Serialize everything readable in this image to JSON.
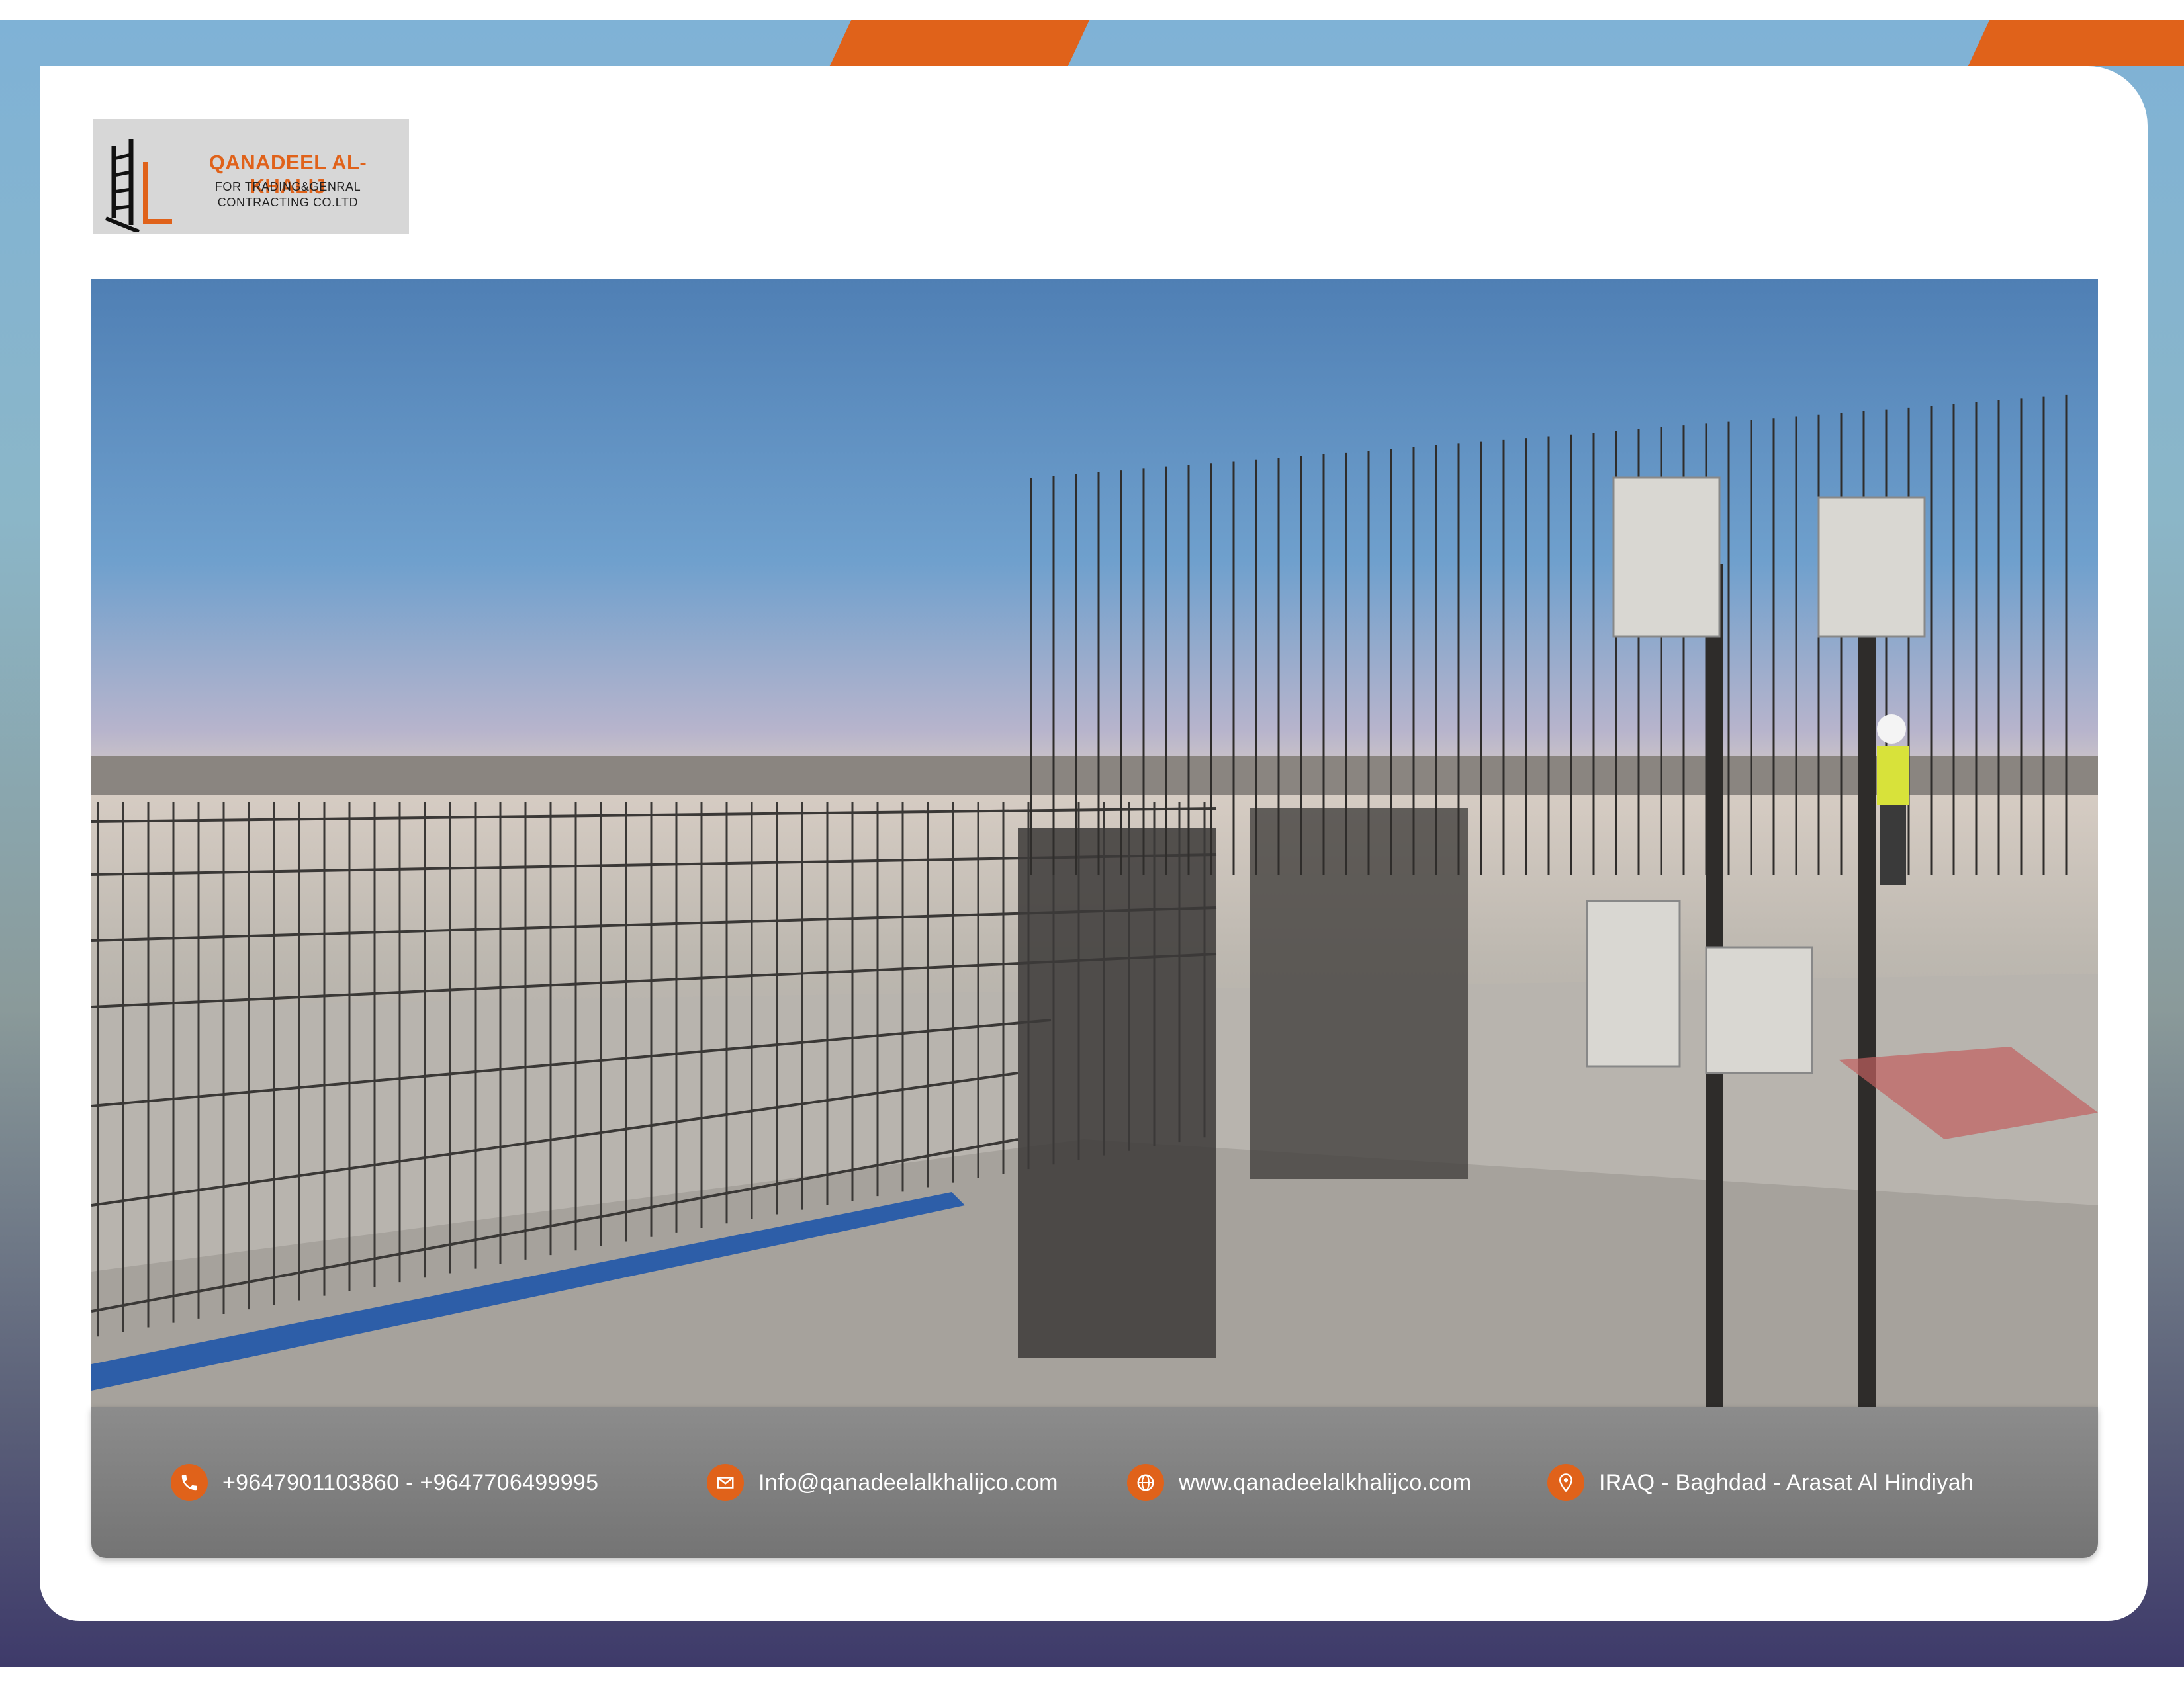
{
  "logo": {
    "brand": "QANADEEL AL-KHALIJ",
    "sub_line1": "FOR TRADING&GENRAL",
    "sub_line2": "CONTRACTING CO.LTD"
  },
  "photo": {
    "subject": "construction site with rebar cages and worker"
  },
  "footer": {
    "phone": "+9647901103860 - +9647706499995",
    "email": "Info@qanadeelalkhalijco.com",
    "website": "www.qanadeelalkhalijco.com",
    "address": "IRAQ - Baghdad - Arasat Al Hindiyah"
  },
  "colors": {
    "accent": "#e0621a",
    "footer_bg": "#7c7c7c"
  },
  "icons": [
    "phone-icon",
    "mail-icon",
    "globe-icon",
    "location-pin-icon"
  ]
}
